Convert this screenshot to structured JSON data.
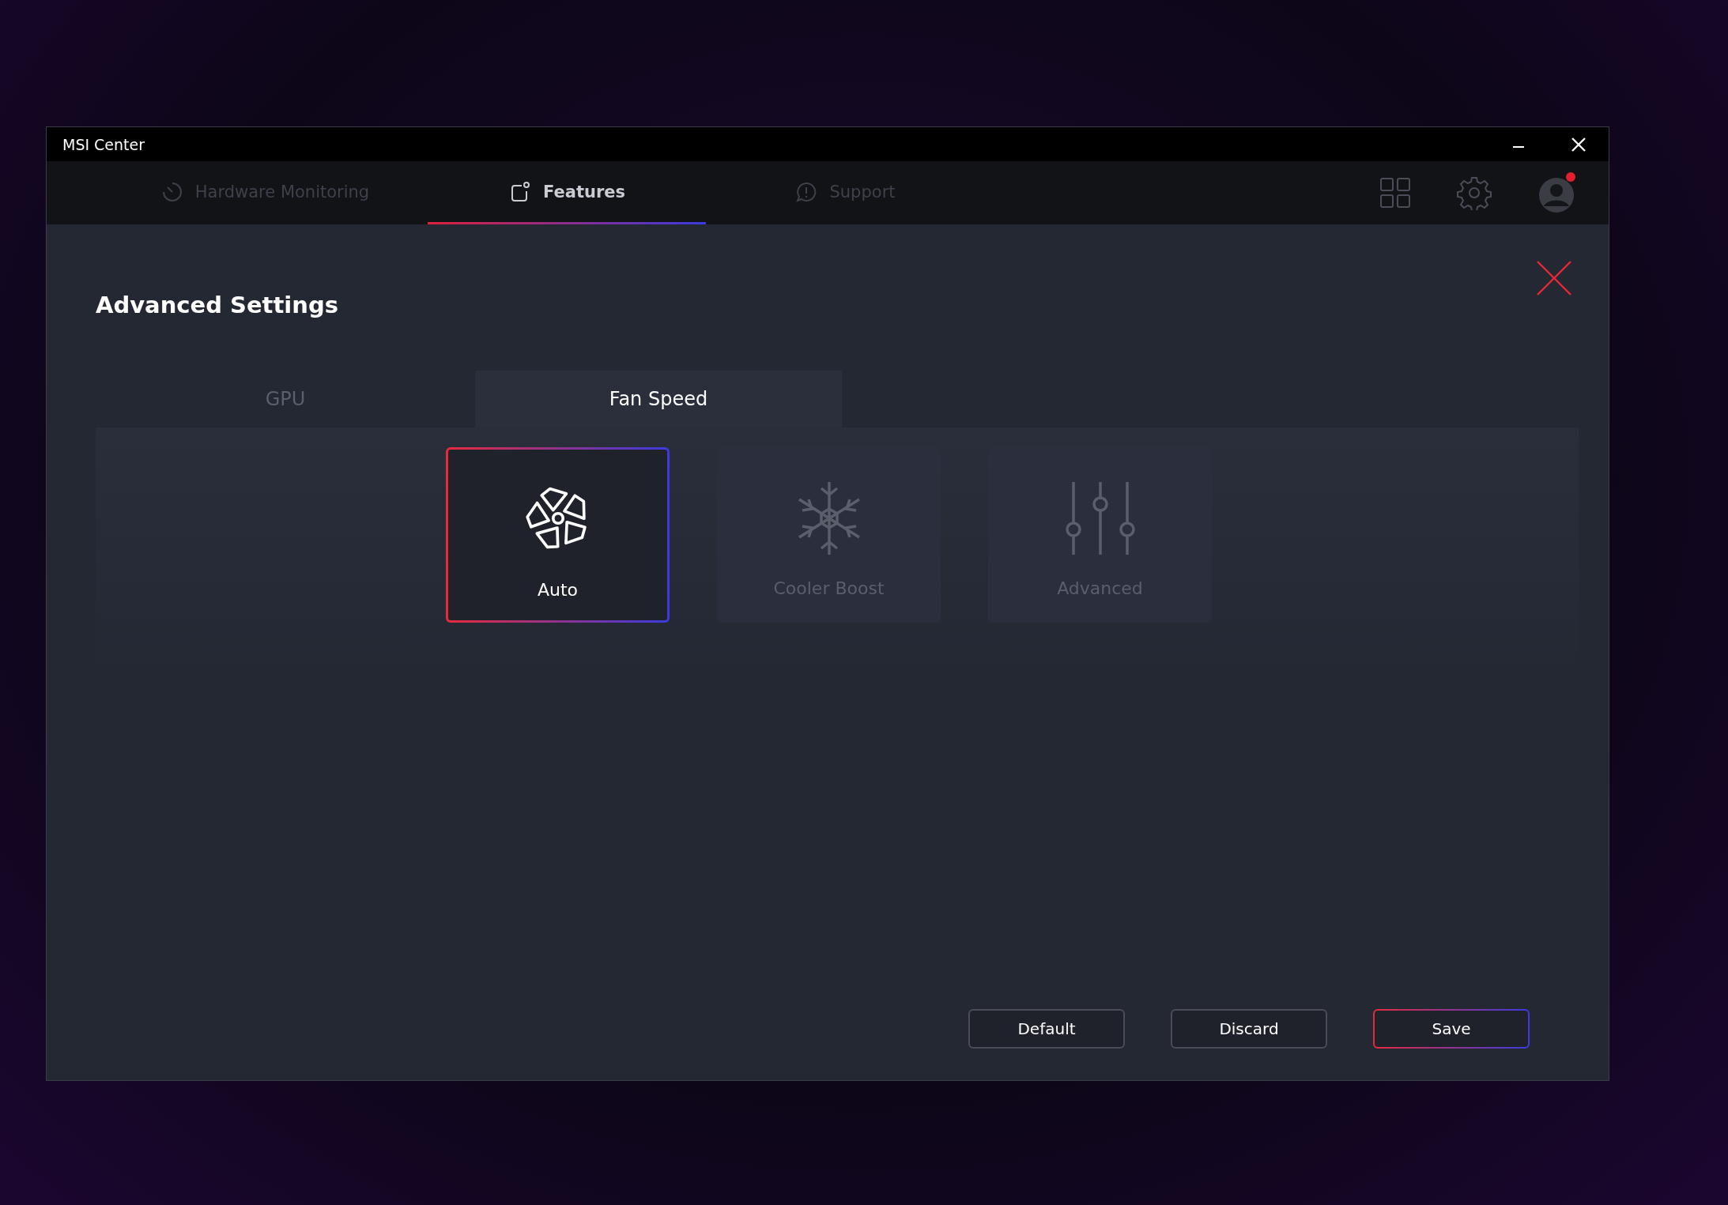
{
  "window": {
    "title": "MSI Center"
  },
  "nav_tabs": [
    {
      "label": "Hardware Monitoring",
      "kind": "gauge",
      "selected": false
    },
    {
      "label": "Features",
      "kind": "features",
      "selected": true
    },
    {
      "label": "Support",
      "kind": "chat",
      "selected": false
    }
  ],
  "page": {
    "title": "Advanced Settings"
  },
  "settings_tabs": [
    {
      "label": "GPU",
      "selected": false
    },
    {
      "label": "Fan Speed",
      "selected": true
    }
  ],
  "fan_modes": [
    {
      "label": "Auto",
      "kind": "fan",
      "selected": true
    },
    {
      "label": "Cooler Boost",
      "kind": "snowflake",
      "selected": false
    },
    {
      "label": "Advanced",
      "kind": "sliders",
      "selected": false
    }
  ],
  "buttons": [
    {
      "label": "Default",
      "kind": "secondary"
    },
    {
      "label": "Discard",
      "kind": "secondary"
    },
    {
      "label": "Save",
      "kind": "primary"
    }
  ]
}
